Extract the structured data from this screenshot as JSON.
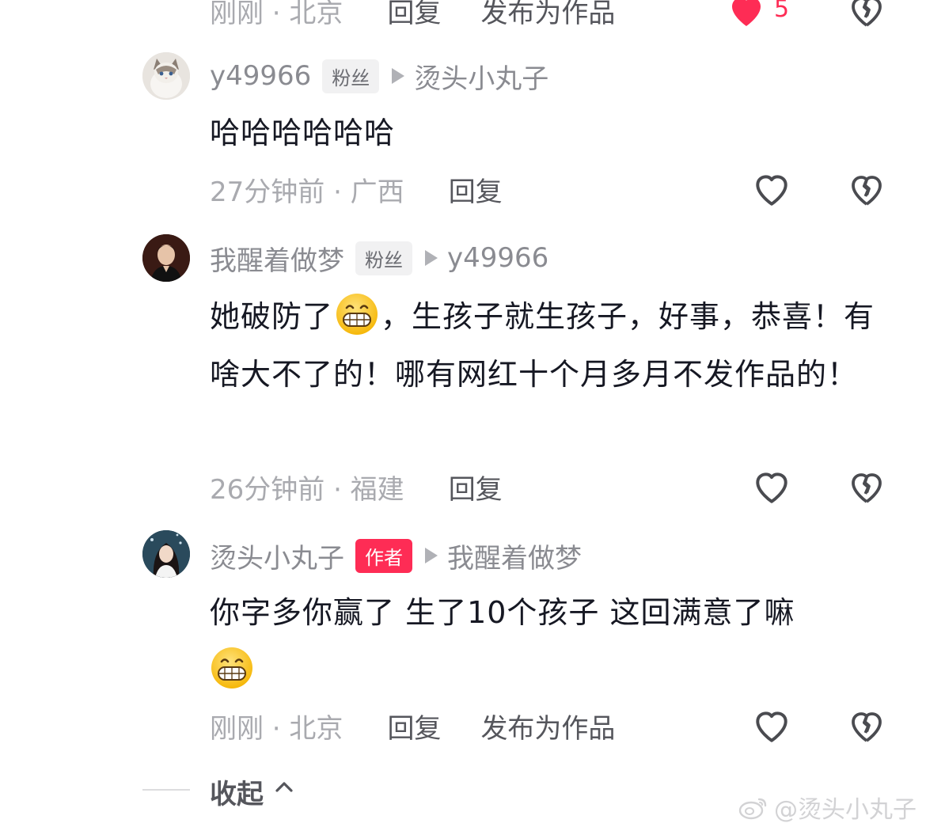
{
  "top_partial": {
    "time_location": "刚刚 · 北京",
    "reply_label": "回复",
    "publish_label": "发布为作品",
    "like_count": "5"
  },
  "comments": [
    {
      "username": "y49966",
      "badge": "粉丝",
      "reply_to": "烫头小丸子",
      "text": "哈哈哈哈哈哈",
      "time_location": "27分钟前 · 广西",
      "reply_label": "回复"
    },
    {
      "username": "我醒着做梦",
      "badge": "粉丝",
      "reply_to": "y49966",
      "text_part1": "她破防了",
      "text_part2": "，生孩子就生孩子，好事，恭喜！有啥大不了的！哪有网红十个月多月不发作品的！",
      "time_location": "26分钟前 · 福建",
      "reply_label": "回复"
    },
    {
      "username": "烫头小丸子",
      "badge": "作者",
      "reply_to": "我醒着做梦",
      "text": "你字多你赢了 生了10个孩子 这回满意了嘛",
      "time_location": "刚刚 · 北京",
      "reply_label": "回复",
      "publish_label": "发布为作品"
    }
  ],
  "collapse_label": "收起",
  "watermark": "@烫头小丸子",
  "icons": {
    "like": "heart-outline-icon",
    "liked": "heart-filled-icon",
    "dislike": "broken-heart-icon",
    "emoji": "grinning-face-icon",
    "collapse": "chevron-up-icon"
  },
  "colors": {
    "accent": "#fe2c55",
    "muted_text": "#8a8b91",
    "body_text": "#161823"
  }
}
